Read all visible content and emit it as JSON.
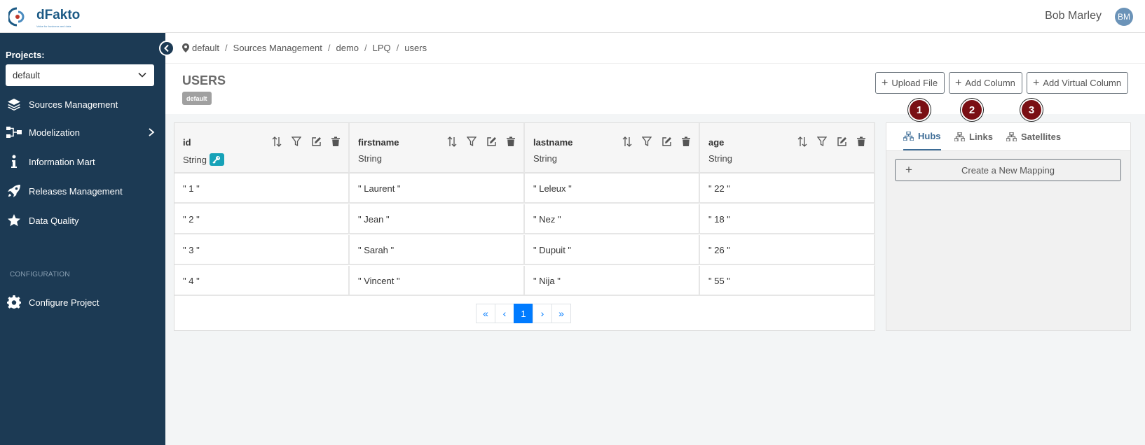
{
  "header": {
    "logo_text": "dFakto",
    "logo_tagline": "Value for business and data",
    "user_name": "Bob Marley",
    "user_initials": "BM"
  },
  "sidebar": {
    "projects_label": "Projects:",
    "project_selected": "default",
    "items": [
      {
        "label": "Sources Management",
        "icon": "layers-icon"
      },
      {
        "label": "Modelization",
        "icon": "diagram-icon",
        "has_submenu": true
      },
      {
        "label": "Information Mart",
        "icon": "info-icon"
      },
      {
        "label": "Releases Management",
        "icon": "rocket-icon"
      },
      {
        "label": "Data Quality",
        "icon": "star-icon"
      }
    ],
    "config_title": "CONFIGURATION",
    "config_items": [
      {
        "label": "Configure Project",
        "icon": "gear-icon"
      }
    ]
  },
  "breadcrumb": [
    "default",
    "Sources Management",
    "demo",
    "LPQ",
    "users"
  ],
  "page": {
    "title": "USERS",
    "badge": "default"
  },
  "toolbar": {
    "upload_label": "Upload File",
    "add_column_label": "Add Column",
    "add_virtual_label": "Add Virtual Column"
  },
  "table": {
    "columns": [
      {
        "name": "id",
        "type": "String",
        "is_key": true
      },
      {
        "name": "firstname",
        "type": "String"
      },
      {
        "name": "lastname",
        "type": "String"
      },
      {
        "name": "age",
        "type": "String"
      }
    ],
    "rows": [
      [
        "\" 1 \"",
        "\" Laurent \"",
        "\" Leleux \"",
        "\" 22 \""
      ],
      [
        "\" 2 \"",
        "\" Jean \"",
        "\" Nez \"",
        "\" 18 \""
      ],
      [
        "\" 3 \"",
        "\" Sarah \"",
        "\" Dupuit \"",
        "\" 26 \""
      ],
      [
        "\" 4 \"",
        "\" Vincent \"",
        "\" Nija \"",
        "\" 55 \""
      ]
    ]
  },
  "pagination": {
    "first": "«",
    "prev": "‹",
    "current": "1",
    "next": "›",
    "last": "»"
  },
  "mapping_panel": {
    "tabs": [
      {
        "label": "Hubs",
        "active": true
      },
      {
        "label": "Links",
        "active": false
      },
      {
        "label": "Satellites",
        "active": false
      }
    ],
    "create_label": "Create a New Mapping"
  },
  "markers": [
    "1",
    "2",
    "3"
  ],
  "colors": {
    "sidebar": "#1c3a54",
    "primary": "#007bff",
    "accent_tab": "#3d6c96",
    "key_badge": "#17a2b8",
    "marker": "#7a0f14"
  }
}
